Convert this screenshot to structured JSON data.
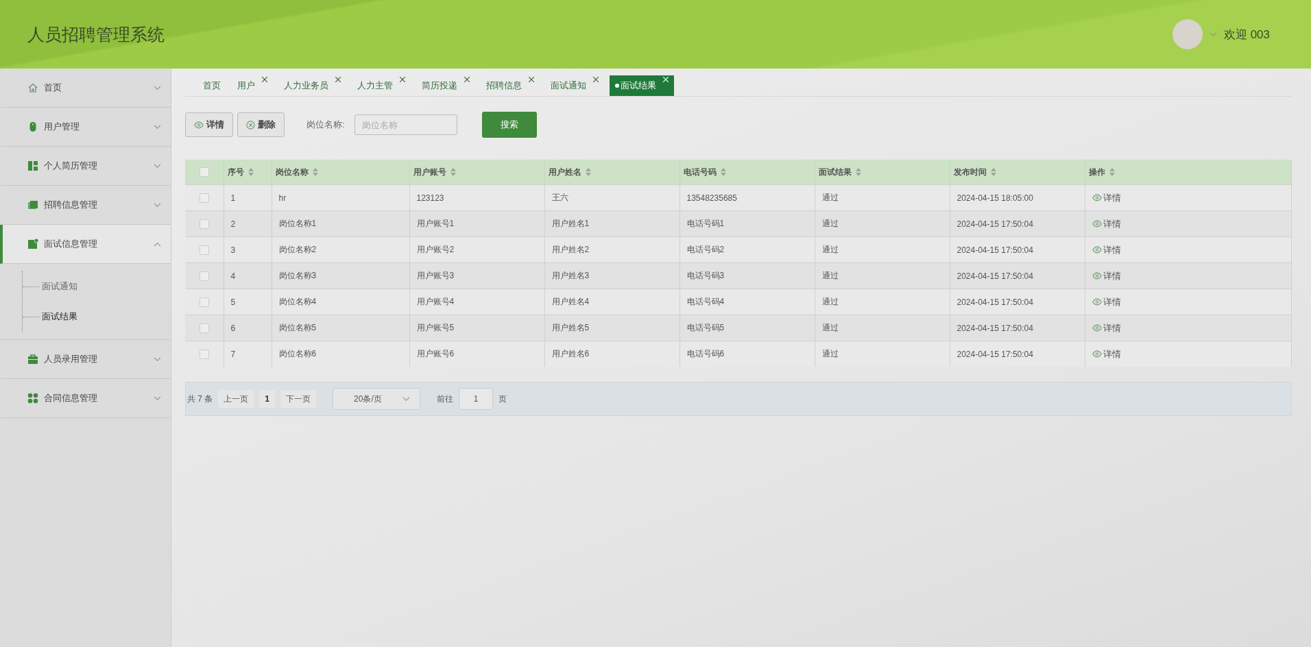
{
  "header": {
    "title": "人员招聘管理系统",
    "greeting": "欢迎 003"
  },
  "sidebar": {
    "items": [
      {
        "label": "首页",
        "selected": false,
        "expanded": false
      },
      {
        "label": "用户管理",
        "selected": false,
        "expanded": false
      },
      {
        "label": "个人简历管理",
        "selected": false,
        "expanded": false
      },
      {
        "label": "招聘信息管理",
        "selected": false,
        "expanded": false
      },
      {
        "label": "面试信息管理",
        "selected": true,
        "expanded": true,
        "children": [
          {
            "label": "面试通知",
            "selected": false
          },
          {
            "label": "面试结果",
            "selected": true
          }
        ]
      },
      {
        "label": "人员录用管理",
        "selected": false,
        "expanded": false
      },
      {
        "label": "合同信息管理",
        "selected": false,
        "expanded": false
      }
    ]
  },
  "tabs": [
    {
      "label": "首页",
      "selected": false,
      "closable": false
    },
    {
      "label": "用户",
      "selected": false,
      "closable": true
    },
    {
      "label": "人力业务员",
      "selected": false,
      "closable": true
    },
    {
      "label": "人力主管",
      "selected": false,
      "closable": true
    },
    {
      "label": "简历投递",
      "selected": false,
      "closable": true
    },
    {
      "label": "招聘信息",
      "selected": false,
      "closable": true
    },
    {
      "label": "面试通知",
      "selected": false,
      "closable": true
    },
    {
      "label": "面试结果",
      "selected": true,
      "closable": true
    }
  ],
  "toolbar": {
    "detail_button": "详情",
    "delete_button": "删除",
    "search_label": "岗位名称:",
    "search_placeholder": "岗位名称",
    "search_button": "搜索"
  },
  "table": {
    "header_checked": false,
    "columns": [
      "序号",
      "岗位名称",
      "用户账号",
      "用户姓名",
      "电话号码",
      "面试结果",
      "发布时间",
      "操作"
    ],
    "rows": [
      {
        "checked": false,
        "cells": [
          "1",
          "hr",
          "123123",
          "王六",
          "13548235685",
          "通过",
          "2024-04-15 18:05:00"
        ],
        "action": "详情"
      },
      {
        "checked": false,
        "cells": [
          "2",
          "岗位名称1",
          "用户账号1",
          "用户姓名1",
          "电话号码1",
          "通过",
          "2024-04-15 17:50:04"
        ],
        "action": "详情"
      },
      {
        "checked": false,
        "cells": [
          "3",
          "岗位名称2",
          "用户账号2",
          "用户姓名2",
          "电话号码2",
          "通过",
          "2024-04-15 17:50:04"
        ],
        "action": "详情"
      },
      {
        "checked": false,
        "cells": [
          "4",
          "岗位名称3",
          "用户账号3",
          "用户姓名3",
          "电话号码3",
          "通过",
          "2024-04-15 17:50:04"
        ],
        "action": "详情"
      },
      {
        "checked": false,
        "cells": [
          "5",
          "岗位名称4",
          "用户账号4",
          "用户姓名4",
          "电话号码4",
          "通过",
          "2024-04-15 17:50:04"
        ],
        "action": "详情"
      },
      {
        "checked": false,
        "cells": [
          "6",
          "岗位名称5",
          "用户账号5",
          "用户姓名5",
          "电话号码5",
          "通过",
          "2024-04-15 17:50:04"
        ],
        "action": "详情"
      },
      {
        "checked": false,
        "cells": [
          "7",
          "岗位名称6",
          "用户账号6",
          "用户姓名6",
          "电话号码6",
          "通过",
          "2024-04-15 17:50:04"
        ],
        "action": "详情"
      }
    ]
  },
  "pagination": {
    "total": "共 7 条",
    "prev": "上一页",
    "page": "1",
    "next": "下一页",
    "page_size": "20条/页",
    "goto_label": "前往",
    "goto_value": "1",
    "goto_suffix": "页"
  }
}
